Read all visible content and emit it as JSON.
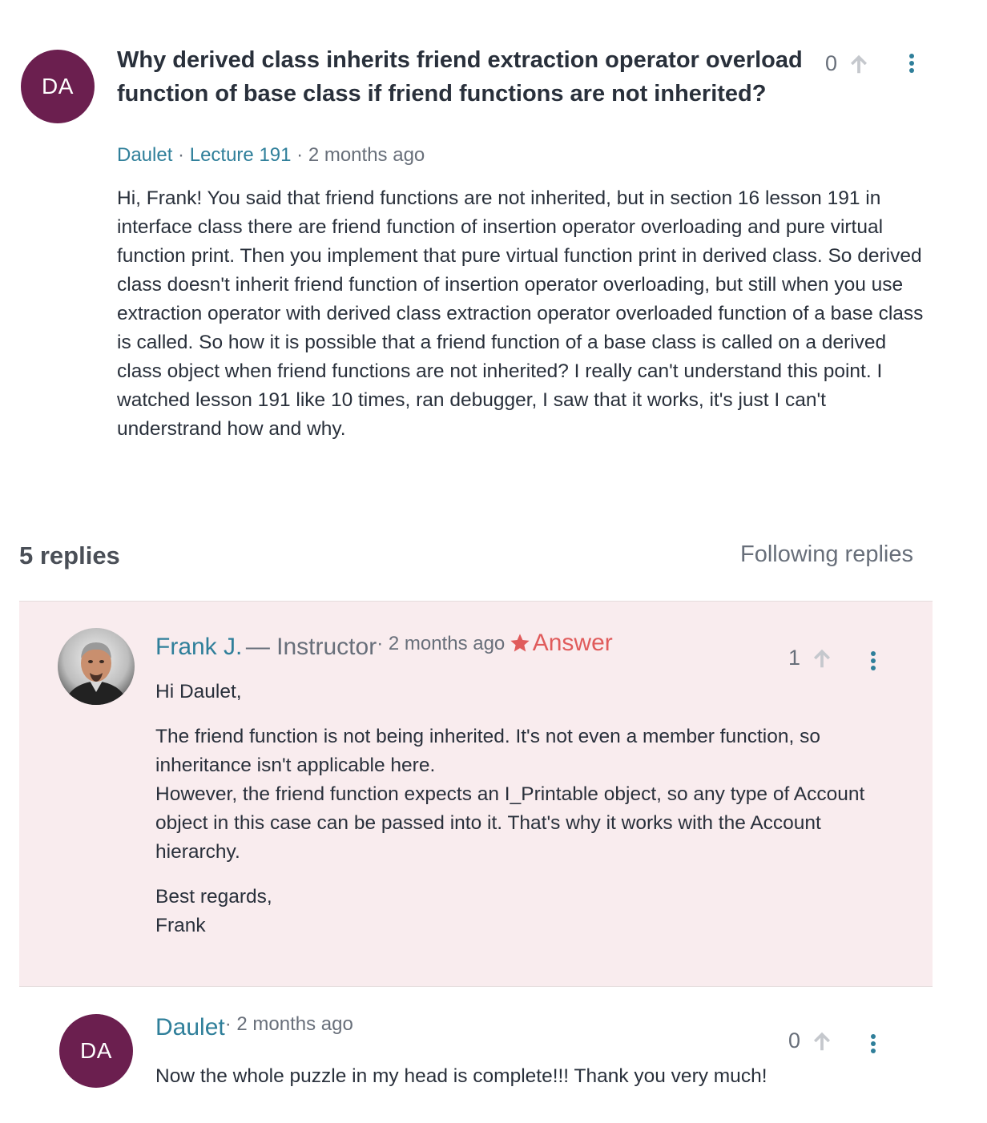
{
  "question": {
    "avatar_initials": "DA",
    "title": "Why derived class inherits friend extraction operator overload function of base class if friend functions are not inherited?",
    "author": "Daulet",
    "lecture": "Lecture 191",
    "time": "2 months ago",
    "body": "Hi, Frank! You said that friend functions are not inherited, but in section 16 lesson 191 in interface class there are friend function of insertion operator overloading and pure virtual function print. Then you implement that pure virtual function print in derived class. So derived class doesn't inherit friend function of insertion operator overloading, but still when you use extraction operator with derived class extraction operator overloaded function of a base class is called. So how it is possible that a friend function of a base class is called on a derived class object when friend functions are not inherited? I really can't understand this point. I watched lesson 191 like 10 times, ran debugger, I saw that it works, it's just I can't understrand how and why.",
    "votes": "0"
  },
  "replies_header": {
    "count_label": "5 replies",
    "following_label": "Following replies"
  },
  "replies": [
    {
      "author": "Frank J.",
      "role": "— Instructor",
      "time": "· 2 months ago",
      "answer_label": "Answer",
      "votes": "1",
      "paragraphs": [
        "Hi Daulet,",
        "The friend function is not being inherited. It's not even a member function, so inheritance isn't applicable here.",
        "However, the friend function expects an I_Printable object, so any type of Account object in this case can be passed into it. That's why it works with the Account hierarchy.",
        "Best regards,",
        "Frank"
      ]
    },
    {
      "avatar_initials": "DA",
      "author": "Daulet",
      "time": "· 2 months ago",
      "votes": "0",
      "body": "Now the whole puzzle in my head is complete!!! Thank you very much!"
    }
  ],
  "colors": {
    "avatar_bg": "#6b1f4f",
    "link": "#2f7f9a",
    "answer_bg": "#f9ecee",
    "answer_star": "#e05b5b"
  },
  "icons": {
    "upvote": "arrow-up-icon",
    "more": "kebab-menu-icon",
    "answer": "star-icon"
  }
}
